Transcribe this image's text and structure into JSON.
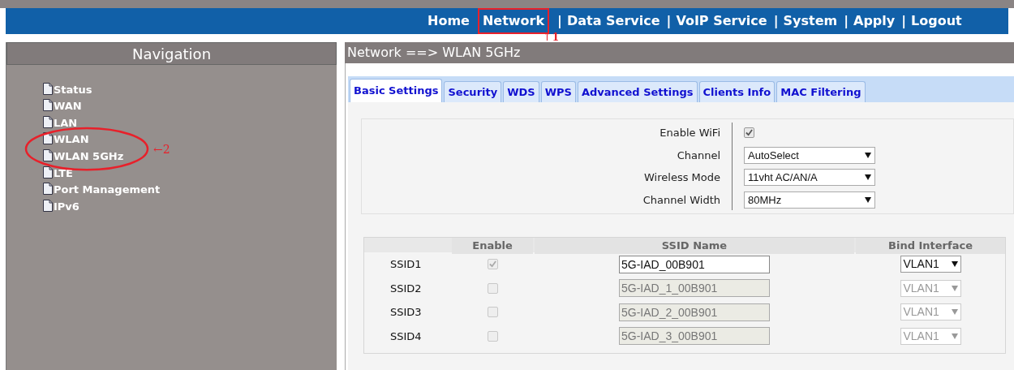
{
  "top_menu": [
    {
      "label": "Home",
      "highlighted": false
    },
    {
      "label": "Network",
      "highlighted": true
    },
    {
      "label": "Data Service",
      "separator": "|",
      "highlighted": false
    },
    {
      "label": "VoIP Service",
      "separator": "|",
      "highlighted": false
    },
    {
      "label": "System",
      "separator": "|",
      "highlighted": false
    },
    {
      "label": "Apply",
      "separator": "|",
      "highlighted": false
    },
    {
      "label": "Logout",
      "separator": "|",
      "highlighted": false
    }
  ],
  "annotations": [
    {
      "kind": "up-arrow",
      "arrow": "↑",
      "number": "1"
    },
    {
      "kind": "left-arrow",
      "text": "←2"
    }
  ],
  "navigation": {
    "title": "Navigation",
    "items": [
      {
        "label": "Status",
        "circled": false
      },
      {
        "label": "WAN",
        "circled": false
      },
      {
        "label": "LAN",
        "circled": false
      },
      {
        "label": "WLAN",
        "circled": true
      },
      {
        "label": "WLAN 5GHz",
        "circled": true
      },
      {
        "label": "LTE",
        "circled": false
      },
      {
        "label": "Port Management",
        "circled": false
      },
      {
        "label": "IPv6",
        "circled": false
      }
    ]
  },
  "breadcrumb": "Network ==> WLAN 5GHz",
  "tabs": [
    {
      "label": "Basic Settings",
      "selected": true
    },
    {
      "label": "Security",
      "selected": false
    },
    {
      "label": "WDS",
      "selected": false
    },
    {
      "label": "WPS",
      "selected": false
    },
    {
      "label": "Advanced Settings",
      "selected": false
    },
    {
      "label": "Clients Info",
      "selected": false
    },
    {
      "label": "MAC Filtering",
      "selected": false
    }
  ],
  "settings": [
    {
      "kind": "checkbox",
      "label": "Enable WiFi",
      "checked": true
    },
    {
      "kind": "select",
      "label": "Channel",
      "value": "AutoSelect"
    },
    {
      "kind": "select",
      "label": "Wireless Mode",
      "value": "11vht AC/AN/A"
    },
    {
      "kind": "select",
      "label": "Channel Width",
      "value": "80MHz"
    }
  ],
  "ssid_table": {
    "columns": [
      "Enable",
      "SSID Name",
      "Bind Interface"
    ],
    "rows": [
      {
        "name": "SSID1",
        "checked": true,
        "disabled": false,
        "ssid": "5G-IAD_00B901",
        "interface": "VLAN1"
      },
      {
        "name": "SSID2",
        "checked": false,
        "disabled": true,
        "ssid": "5G-IAD_1_00B901",
        "interface": "VLAN1"
      },
      {
        "name": "SSID3",
        "checked": false,
        "disabled": true,
        "ssid": "5G-IAD_2_00B901",
        "interface": "VLAN1"
      },
      {
        "name": "SSID4",
        "checked": false,
        "disabled": true,
        "ssid": "5G-IAD_3_00B901",
        "interface": "VLAN1"
      }
    ]
  }
}
